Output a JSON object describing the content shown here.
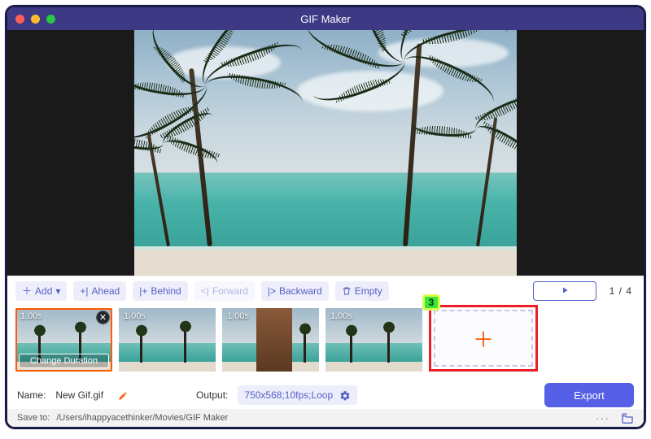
{
  "window": {
    "title": "GIF Maker"
  },
  "toolbar": {
    "add": "Add",
    "ahead": "Ahead",
    "behind": "Behind",
    "forward": "Forward",
    "backward": "Backward",
    "empty": "Empty"
  },
  "playback": {
    "current": "1",
    "sep": " / ",
    "total": "4"
  },
  "filmstrip": {
    "thumbs": [
      {
        "duration": "1.00s",
        "selected": true,
        "change_label": "Change Duration"
      },
      {
        "duration": "1.00s",
        "selected": false
      },
      {
        "duration": "1.00s",
        "selected": false
      },
      {
        "duration": "1.00s",
        "selected": false
      }
    ],
    "add_badge": "3"
  },
  "form": {
    "name_label": "Name:",
    "name_value": "New Gif.gif",
    "output_label": "Output:",
    "output_value": "750x568;10fps;Loop",
    "export": "Export",
    "save_label": "Save to:",
    "save_path": "/Users/ihappyacethinker/Movies/GIF Maker"
  }
}
